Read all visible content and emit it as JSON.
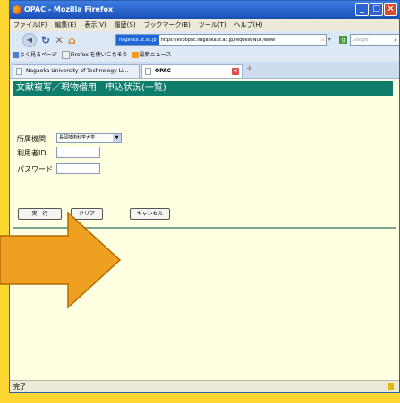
{
  "window": {
    "title": "OPAC - Mozilla Firefox"
  },
  "menu": [
    "ファイル(F)",
    "編集(E)",
    "表示(V)",
    "履歴(S)",
    "ブックマーク(B)",
    "ツール(T)",
    "ヘルプ(H)"
  ],
  "address": {
    "site": "nagaoka.ut.ac.jp",
    "url": "https://elibopac.nagaokaut.ac.jp/request/NUT/www"
  },
  "search": {
    "placeholder": "Google"
  },
  "bookmarks": [
    "よく見るページ",
    "Firefox を使いこなそう",
    "最新ニュース"
  ],
  "tabs": [
    {
      "label": "Nagaoka University of Technology Li..."
    },
    {
      "label": "OPAC"
    }
  ],
  "page": {
    "title": "文献複写／現物借用　申込状況(一覧)",
    "institution_label": "所属機関",
    "institution_value": "長岡技術科学大学",
    "userid_label": "利用者ID",
    "password_label": "パスワード",
    "buttons": {
      "run": "実　行",
      "clear": "クリア",
      "cancel": "キャンセル"
    }
  },
  "status": "完了",
  "colors": {
    "heading": "#0e7d6b",
    "page_bg": "#ffffe1",
    "frame": "#fdd632",
    "arrow": "#f0a020"
  }
}
